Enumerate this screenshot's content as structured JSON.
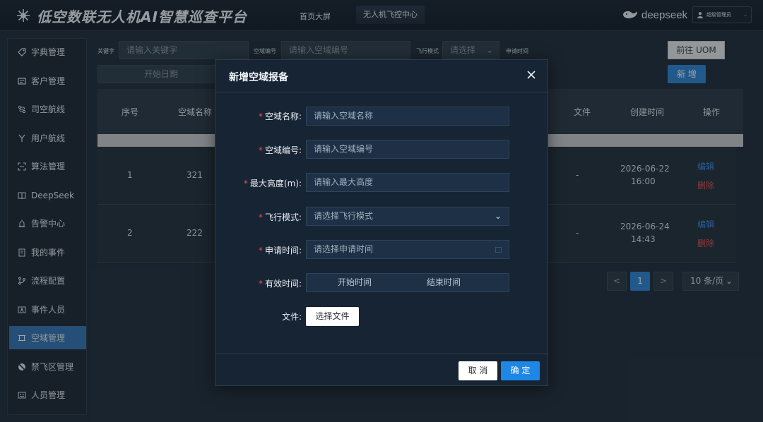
{
  "header": {
    "title": "低空数联无人机AI智慧巡查平台",
    "nav": [
      "首页大屏",
      "无人机飞控中心"
    ],
    "brand": "deepseek",
    "user": "超级管理员"
  },
  "sidebar": {
    "items": [
      {
        "label": "字典管理",
        "icon": "tag-icon"
      },
      {
        "label": "客户管理",
        "icon": "id-card-icon"
      },
      {
        "label": "司空航线",
        "icon": "route-icon"
      },
      {
        "label": "用户航线",
        "icon": "branch-icon"
      },
      {
        "label": "算法管理",
        "icon": "scan-icon"
      },
      {
        "label": "DeepSeek",
        "icon": "book-icon"
      },
      {
        "label": "告警中心",
        "icon": "alarm-icon"
      },
      {
        "label": "我的事件",
        "icon": "document-icon"
      },
      {
        "label": "流程配置",
        "icon": "flow-icon"
      },
      {
        "label": "事件人员",
        "icon": "person-card-icon"
      },
      {
        "label": "空域管理",
        "icon": "airspace-icon",
        "active": true
      },
      {
        "label": "禁飞区管理",
        "icon": "no-fly-icon"
      },
      {
        "label": "人员管理",
        "icon": "staff-icon"
      }
    ]
  },
  "filters": {
    "keyword_label": "关键字",
    "keyword_placeholder": "请输入关键字",
    "code_label": "空域编号",
    "code_placeholder": "请输入空域编号",
    "mode_label": "飞行模式",
    "mode_placeholder": "请选择",
    "apply_time_label": "申请时间",
    "start_date_placeholder": "开始日期",
    "uom_button": "前往 UOM",
    "add_button": "新 增"
  },
  "table": {
    "columns": [
      "序号",
      "空域名称",
      "文件",
      "创建时间",
      "操作"
    ],
    "rows": [
      {
        "index": "1",
        "name": "321",
        "file": "-",
        "date": "2026-06-22",
        "time": "16:00",
        "edit": "编辑",
        "delete": "删除"
      },
      {
        "index": "2",
        "name": "222",
        "file": "-",
        "date": "2026-06-24",
        "time": "14:43",
        "edit": "编辑",
        "delete": "删除"
      }
    ]
  },
  "pagination": {
    "prev": "<",
    "current": "1",
    "next": ">",
    "page_size": "10 条/页"
  },
  "modal": {
    "title": "新增空域报备",
    "required_mark": "*",
    "fields": {
      "name": {
        "label": "空域名称:",
        "placeholder": "请输入空域名称"
      },
      "code": {
        "label": "空域编号:",
        "placeholder": "请输入空域编号"
      },
      "height": {
        "label": "最大高度(m):",
        "placeholder": "请输入最大高度"
      },
      "mode": {
        "label": "飞行模式:",
        "placeholder": "请选择飞行模式"
      },
      "apply_time": {
        "label": "申请时间:",
        "placeholder": "请选择申请时间"
      },
      "valid_time": {
        "label": "有效时间:",
        "start_placeholder": "开始时间",
        "end_placeholder": "结束时间"
      },
      "file": {
        "label": "文件:",
        "button": "选择文件"
      }
    },
    "cancel_button": "取 消",
    "ok_button": "确 定"
  },
  "colors": {
    "accent": "#2f86d6",
    "danger": "#e05252",
    "sidebar_active": "#3777b3"
  }
}
